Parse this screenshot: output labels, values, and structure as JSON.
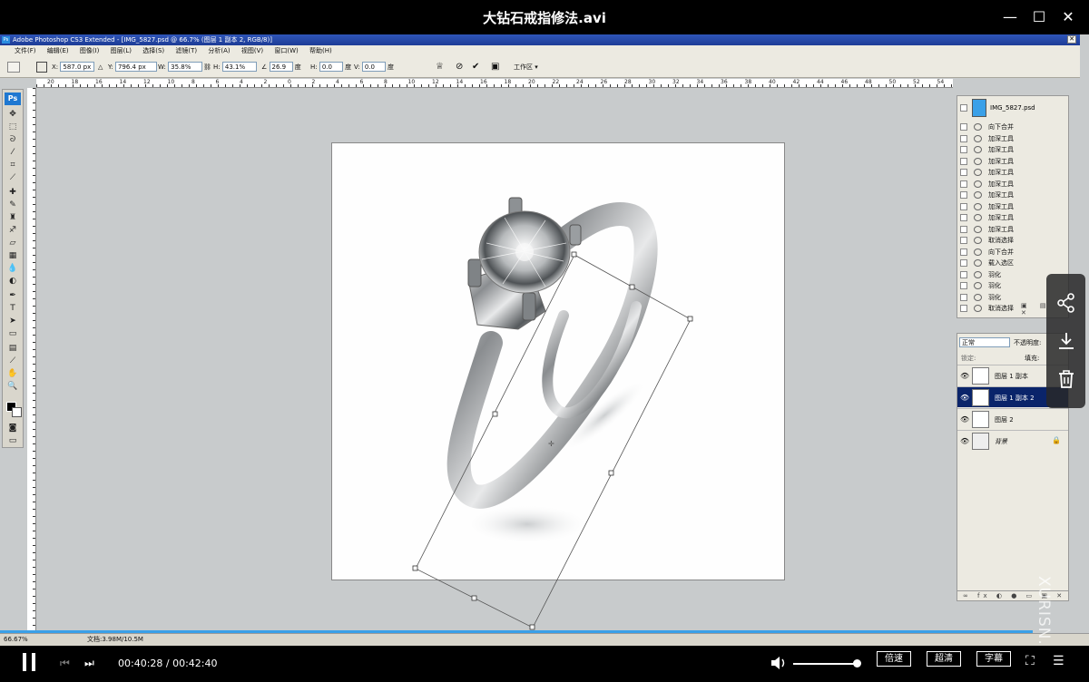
{
  "player": {
    "title": "大钻石戒指修法.avi",
    "time": "00:40:28 / 00:42:40",
    "speed_label": "倍速",
    "quality_label": "超清",
    "subtitle_label": "字幕",
    "watermark": "XURISN.COM"
  },
  "photoshop": {
    "title": "Adobe Photoshop CS3 Extended - [IMG_5827.psd @ 66.7% (图层 1 副本 2, RGB/8)]",
    "menu": [
      "文件(F)",
      "编辑(E)",
      "图像(I)",
      "图层(L)",
      "选择(S)",
      "滤镜(T)",
      "分析(A)",
      "视图(V)",
      "窗口(W)",
      "帮助(H)"
    ],
    "options": {
      "x_label": "X:",
      "x_value": "587.0 px",
      "y_label": "Y:",
      "y_value": "796.4 px",
      "w_label": "W:",
      "w_value": "35.8%",
      "h_label": "H:",
      "h_value": "43.1%",
      "angle_value": "26.9",
      "angle_unit": "度",
      "hskew_label": "H:",
      "hskew_value": "0.0",
      "hskew_unit": "度",
      "vskew_label": "V:",
      "vskew_value": "0.0",
      "vskew_unit": "度",
      "workspace": "工作区 ▾"
    },
    "ruler_numbers": [
      "20",
      "18",
      "16",
      "14",
      "12",
      "10",
      "8",
      "6",
      "4",
      "2",
      "0",
      "2",
      "4",
      "6",
      "8",
      "10",
      "12",
      "14",
      "16",
      "18",
      "20",
      "22",
      "24",
      "26",
      "28",
      "30",
      "32",
      "34",
      "36",
      "38",
      "40",
      "42",
      "44",
      "46",
      "48",
      "50",
      "52",
      "54"
    ],
    "status": {
      "zoom": "66.67%",
      "doc": "文档:3.98M/10.5M"
    },
    "history": {
      "snapshot": "IMG_5827.psd",
      "items": [
        "向下合并",
        "加深工具",
        "加深工具",
        "加深工具",
        "加深工具",
        "加深工具",
        "加深工具",
        "加深工具",
        "加深工具",
        "加深工具",
        "取消选择",
        "向下合并",
        "载入选区",
        "羽化",
        "羽化",
        "羽化",
        "取消选择"
      ]
    },
    "layers": {
      "blend_mode": "正常",
      "opacity_label": "不透明度:",
      "lock_label": "锁定:",
      "fill_label": "填充:",
      "items": [
        {
          "name": "图层 1 副本",
          "active": false
        },
        {
          "name": "图层 1 副本 2",
          "active": true
        },
        {
          "name": "图层 2",
          "active": false
        },
        {
          "name": "背景",
          "active": false
        }
      ],
      "footer": "∞ fx ◐ ● ▭ ▣ ✕"
    }
  },
  "colors": {
    "ps_workspace": "#c8cbcc",
    "ps_title": "#1d3c96",
    "active_layer": "#0a246a",
    "progress": "#3aa0e8"
  }
}
